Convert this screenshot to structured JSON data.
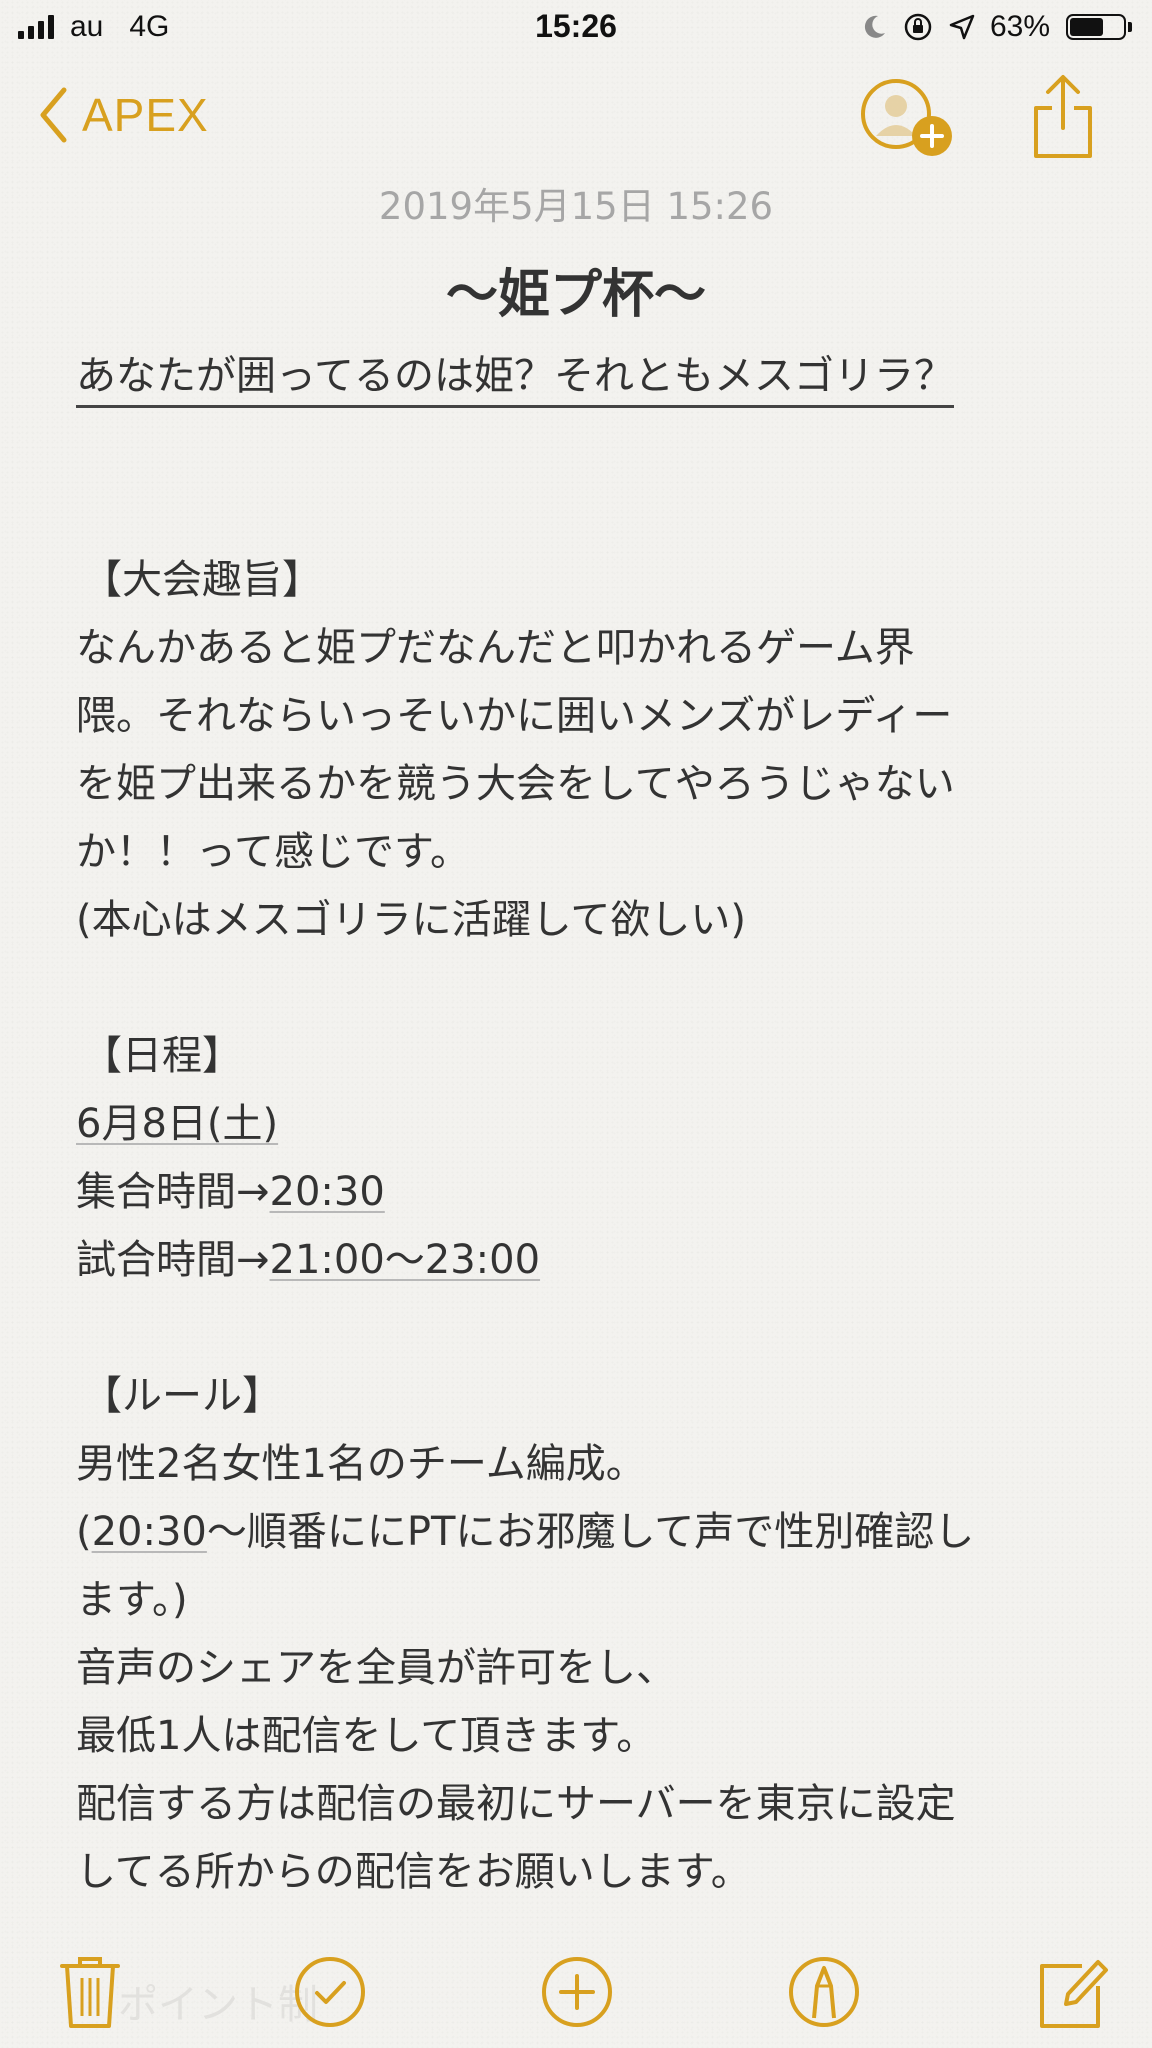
{
  "status_bar": {
    "carrier": "au",
    "network": "4G",
    "time": "15:26",
    "battery_percent": "63%",
    "battery_level": 0.63
  },
  "nav": {
    "back_label": "APEX",
    "accent_color": "#d8a01f"
  },
  "note": {
    "date": "2019年5月15日 15:26",
    "title": "〜姫プ杯〜",
    "subtitle": "あなたが囲ってるのは姫？それともメスゴリラ？",
    "section_purpose": {
      "heading": "【大会趣旨】",
      "lines": [
        "なんかあると姫プだなんだと叩かれるゲーム界",
        "隈。それならいっそいかに囲いメンズがレディー",
        "を姫プ出来るかを競う大会をしてやろうじゃない",
        "か！！って感じです。",
        "(本心はメスゴリラに活躍して欲しい)"
      ]
    },
    "section_schedule": {
      "heading": "【日程】",
      "date": "6月8日(土)",
      "gather_label": "集合時間→",
      "gather_time": "20:30",
      "match_label": "試合時間→",
      "match_time": "21:00〜23:00"
    },
    "section_rules": {
      "heading": "【ルール】",
      "line1": "男性2名女性1名のチーム編成。",
      "line2_open": "(",
      "line2_time": "20:30",
      "line2_rest": "〜順番ににPTにお邪魔して声で性別確認し",
      "line3": "ます。)",
      "line4": "音声のシェアを全員が許可をし、",
      "line5": "最低1人は配信をして頂きます。",
      "line6": "配信する方は配信の最初にサーバーを東京に設定",
      "line7": "してる所からの配信をお願いします。"
    }
  },
  "toolbar": {
    "ghost_text": "ポイント制"
  }
}
